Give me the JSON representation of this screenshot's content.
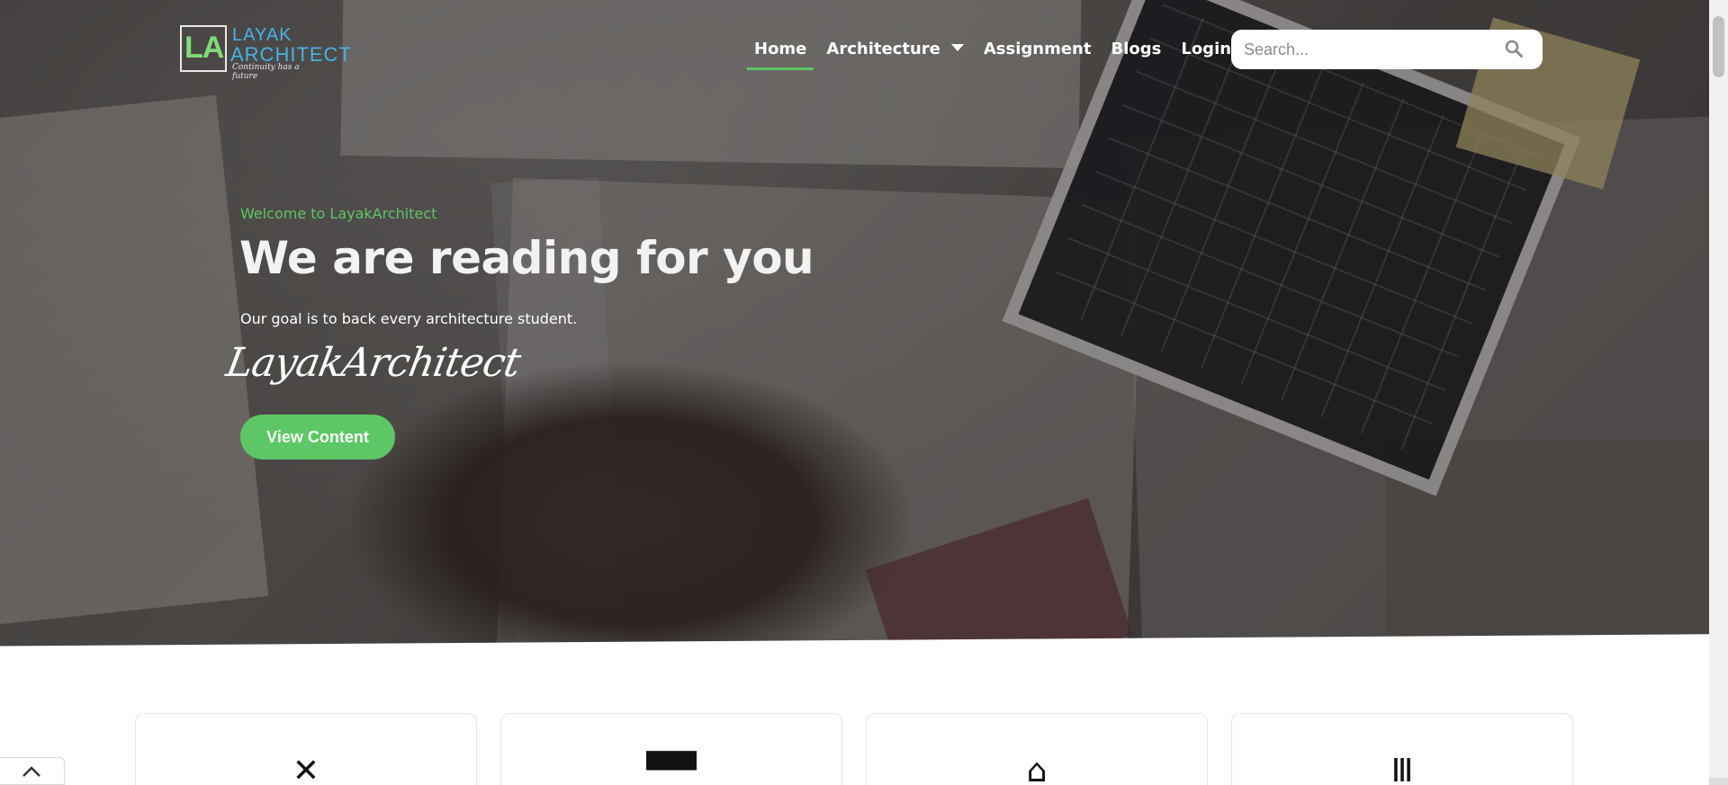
{
  "brand": {
    "monogram": "LA",
    "name_line1": "LAYAK",
    "name_line2": "ARCHITECT",
    "tagline": "Continuity has a future"
  },
  "nav": {
    "items": [
      {
        "label": "Home",
        "active": true
      },
      {
        "label": "Architecture",
        "has_dropdown": true
      },
      {
        "label": "Assignment"
      },
      {
        "label": "Blogs"
      },
      {
        "label": "Login"
      }
    ]
  },
  "search": {
    "placeholder": "Search...",
    "icon": "search-icon"
  },
  "hero": {
    "welcome": "Welcome to LayakArchitect",
    "headline": "We are reading for you",
    "subtitle": "Our goal is to back every architecture student.",
    "signature": "LayakArchitect",
    "cta_label": "View Content"
  },
  "cards": [
    {
      "icon": "tools-icon",
      "glyph": "✕"
    },
    {
      "icon": "building-icon",
      "glyph": "▀▀"
    },
    {
      "icon": "house-icon",
      "glyph": "⌂"
    },
    {
      "icon": "column-icon",
      "glyph": "Ⅲ"
    }
  ],
  "colors": {
    "accent": "#5cc764",
    "logo_blue": "#46b3e6",
    "text_light": "#f2f2f2"
  },
  "back_to_top": {
    "icon": "chevron-up-icon"
  }
}
